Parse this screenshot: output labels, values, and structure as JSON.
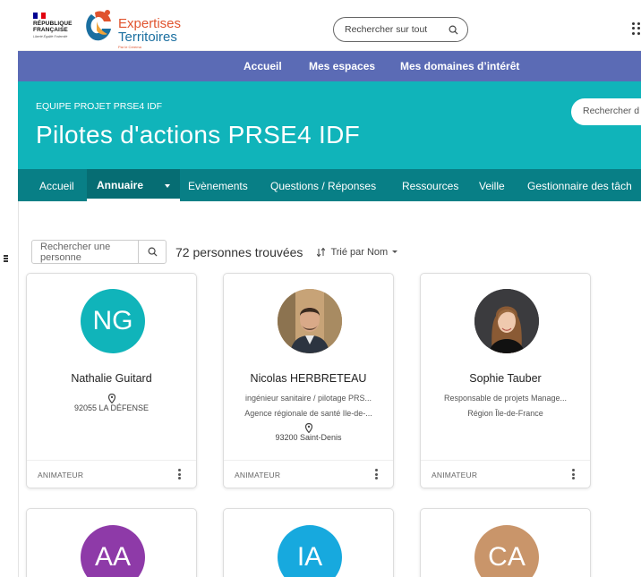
{
  "header": {
    "republic_line1": "RÉPUBLIQUE",
    "republic_line2": "FRANÇAISE",
    "republic_motto": "Liberté Égalité Fraternité",
    "brand_line1": "Expertises",
    "brand_line2": "Territoires",
    "brand_sub": "Par le Cerema",
    "search_placeholder": "Rechercher sur tout",
    "colors": {
      "brand_orange": "#e0532e",
      "brand_blue": "#1b6fa0"
    }
  },
  "main_nav": {
    "items": [
      {
        "label": "Accueil"
      },
      {
        "label": "Mes espaces"
      },
      {
        "label": "Mes domaines d’intérêt"
      }
    ],
    "color": "#5b6bb5"
  },
  "space": {
    "group": "EQUIPE PROJET PRSE4 IDF",
    "title": "Pilotes d'actions PRSE4 IDF",
    "search_placeholder": "Rechercher d",
    "color": "#10b4ba"
  },
  "tabs": {
    "items": [
      {
        "label": "Accueil"
      },
      {
        "label": "Annuaire"
      },
      {
        "label": "Evènements"
      },
      {
        "label": "Questions / Réponses"
      },
      {
        "label": "Ressources"
      },
      {
        "label": "Veille"
      },
      {
        "label": "Gestionnaire des tâch"
      }
    ],
    "active": "Annuaire",
    "color": "#087f86"
  },
  "directory": {
    "search_placeholder": "Rechercher une personne",
    "result_count": "72 personnes trouvées",
    "sort_label": "Trié par Nom",
    "people": [
      {
        "initials": "NG",
        "avatar_color": "#10b4ba",
        "name": "Nathalie Guitard",
        "location": "92055 LA DÉFENSE",
        "role": "ANIMATEUR"
      },
      {
        "initials": "",
        "photo": "man-portrait",
        "name": "Nicolas HERBRETEAU",
        "line1": "ingénieur sanitaire / pilotage PRS...",
        "line2": "Agence régionale de santé Ile-de-...",
        "location": "93200 Saint-Denis",
        "role": "ANIMATEUR"
      },
      {
        "initials": "",
        "photo": "woman-portrait",
        "name": "Sophie Tauber",
        "line1": "Responsable de projets Manage...",
        "line2": "Région Île-de-France",
        "role": "ANIMATEUR"
      },
      {
        "initials": "AA",
        "avatar_color": "#8e3aa8"
      },
      {
        "initials": "IA",
        "avatar_color": "#17a9de"
      },
      {
        "initials": "CA",
        "avatar_color": "#c9956a"
      }
    ]
  }
}
